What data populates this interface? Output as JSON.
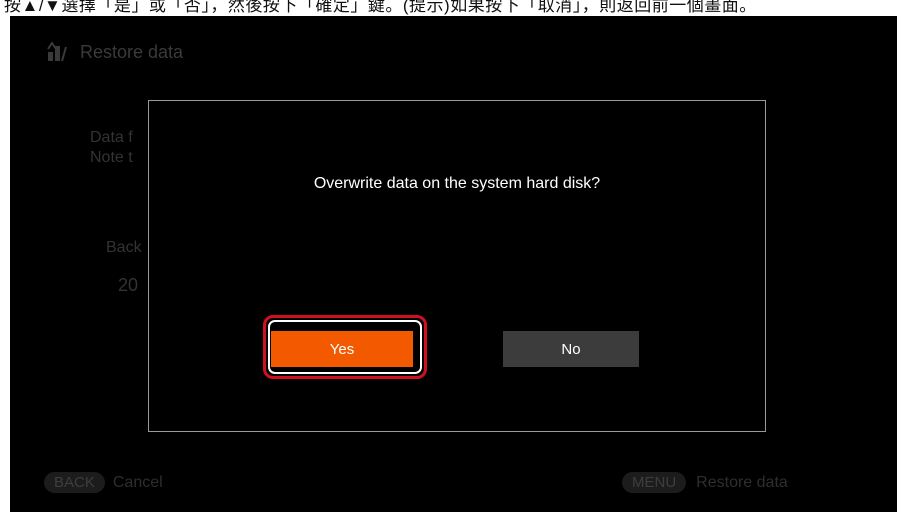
{
  "top_strip": {
    "text": "按▲/▼選擇「是」或「否」，然後按下「確定」鍵。(提示)如果按下「取消」，則返回前一個畫面。"
  },
  "background": {
    "header_icon": "restore-data-icon",
    "title": "Restore data",
    "line1": "Data f",
    "line2": "Note t",
    "line3": "Back",
    "line4": "20"
  },
  "dialog": {
    "message": "Overwrite data on the system hard disk?",
    "yes_label": "Yes",
    "no_label": "No",
    "selected": "Yes"
  },
  "footer": {
    "back_key": "BACK",
    "back_label": "Cancel",
    "menu_key": "MENU",
    "menu_label": "Restore data"
  },
  "colors": {
    "screen_bg": "#000000",
    "selected_button": "#f35a00",
    "unselected_button": "#3c3c3c",
    "highlight_ring": "#d01020",
    "dialog_border": "#9a9a9a"
  }
}
